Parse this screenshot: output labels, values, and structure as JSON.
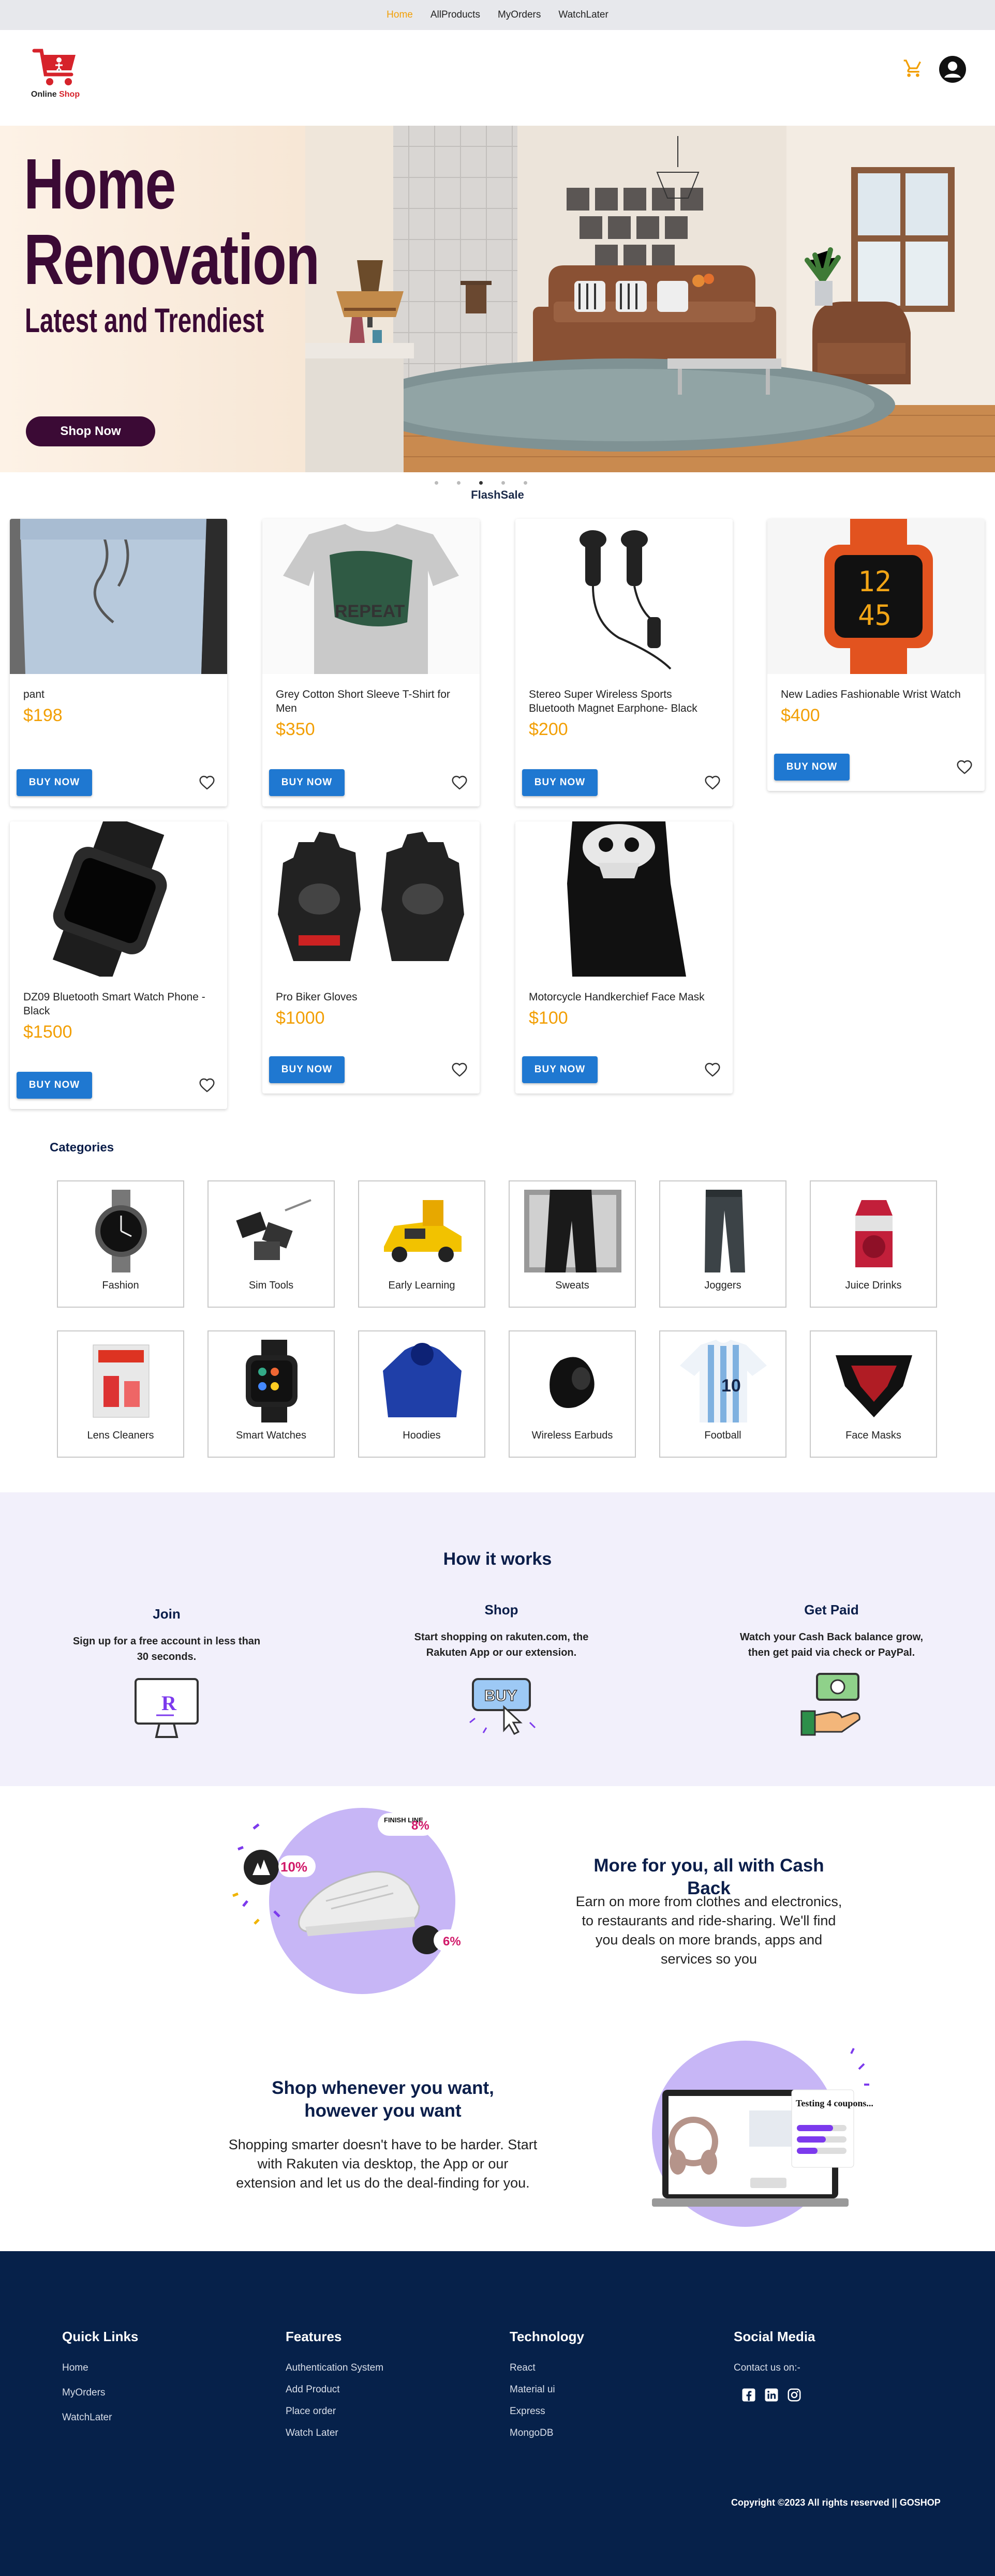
{
  "topnav": {
    "home": "Home",
    "all_products": "AllProducts",
    "my_orders": "MyOrders",
    "watch_later": "WatchLater"
  },
  "logo": {
    "word1": "Online",
    "word2": "Shop"
  },
  "hero": {
    "title_line1": "Home",
    "title_line2": "Renovation",
    "subtitle": "Latest and Trendiest",
    "cta": "Shop Now"
  },
  "flash_sale": "FlashSale",
  "buy_label": "BUY NOW",
  "products": [
    {
      "name": "pant",
      "price": "$198"
    },
    {
      "name": "Grey Cotton Short Sleeve T-Shirt for Men",
      "price": "$350"
    },
    {
      "name": "Stereo Super Wireless Sports Bluetooth Magnet Earphone- Black",
      "price": "$200"
    },
    {
      "name": "New Ladies Fashionable Wrist Watch",
      "price": "$400"
    },
    {
      "name": "DZ09 Bluetooth Smart Watch Phone - Black",
      "price": "$1500"
    },
    {
      "name": "Pro Biker Gloves",
      "price": "$1000"
    },
    {
      "name": "Motorcycle Handkerchief Face Mask",
      "price": "$100"
    }
  ],
  "categories_title": "Categories",
  "categories": [
    "Fashion",
    "Sim Tools",
    "Early Learning",
    "Sweats",
    "Joggers",
    "Juice Drinks",
    "Lens Cleaners",
    "Smart Watches",
    "Hoodies",
    "Wireless Earbuds",
    "Football",
    "Face Masks"
  ],
  "how": {
    "title": "How it works",
    "steps": [
      {
        "title": "Join",
        "text": "Sign up for a free account in less than 30 seconds."
      },
      {
        "title": "Shop",
        "text": "Start shopping on rakuten.com, the Rakuten App or our extension."
      },
      {
        "title": "Get Paid",
        "text": "Watch your Cash Back balance grow, then get paid via check or PayPal."
      }
    ],
    "buy_icon_text": "BUY"
  },
  "cashback": {
    "title": "More for you, all with Cash Back",
    "text": "Earn on more from clothes and electronics, to restaurants and ride-sharing. We'll find you deals on more brands, apps and services so you",
    "badges": [
      "10%",
      "8%",
      "6%"
    ],
    "finish_line": "FINISH LINE"
  },
  "shopwhenever": {
    "title": "Shop whenever you want, however you want",
    "text": "Shopping smarter doesn't have to be harder. Start with Rakuten via desktop, the App or our extension and let us do the deal-finding for you.",
    "laptop_text": "Testing 4 coupons..."
  },
  "footer": {
    "quick_links": {
      "title": "Quick Links",
      "items": [
        "Home",
        "MyOrders",
        "WatchLater"
      ]
    },
    "features": {
      "title": "Features",
      "items": [
        "Authentication System",
        "Add Product",
        "Place order",
        "Watch Later"
      ]
    },
    "technology": {
      "title": "Technology",
      "items": [
        "React",
        "Material ui",
        "Express",
        "MongoDB"
      ]
    },
    "social": {
      "title": "Social Media",
      "contact": "Contact us on:-"
    },
    "copyright": "Copyright ©2023 All rights reserved || GOSHOP"
  },
  "colors": {
    "accent": "#f29f05",
    "buy_button": "#1f78d1",
    "hero_text": "#3b0a35",
    "footer_bg": "#06214a",
    "navy": "#0b1e4a"
  }
}
